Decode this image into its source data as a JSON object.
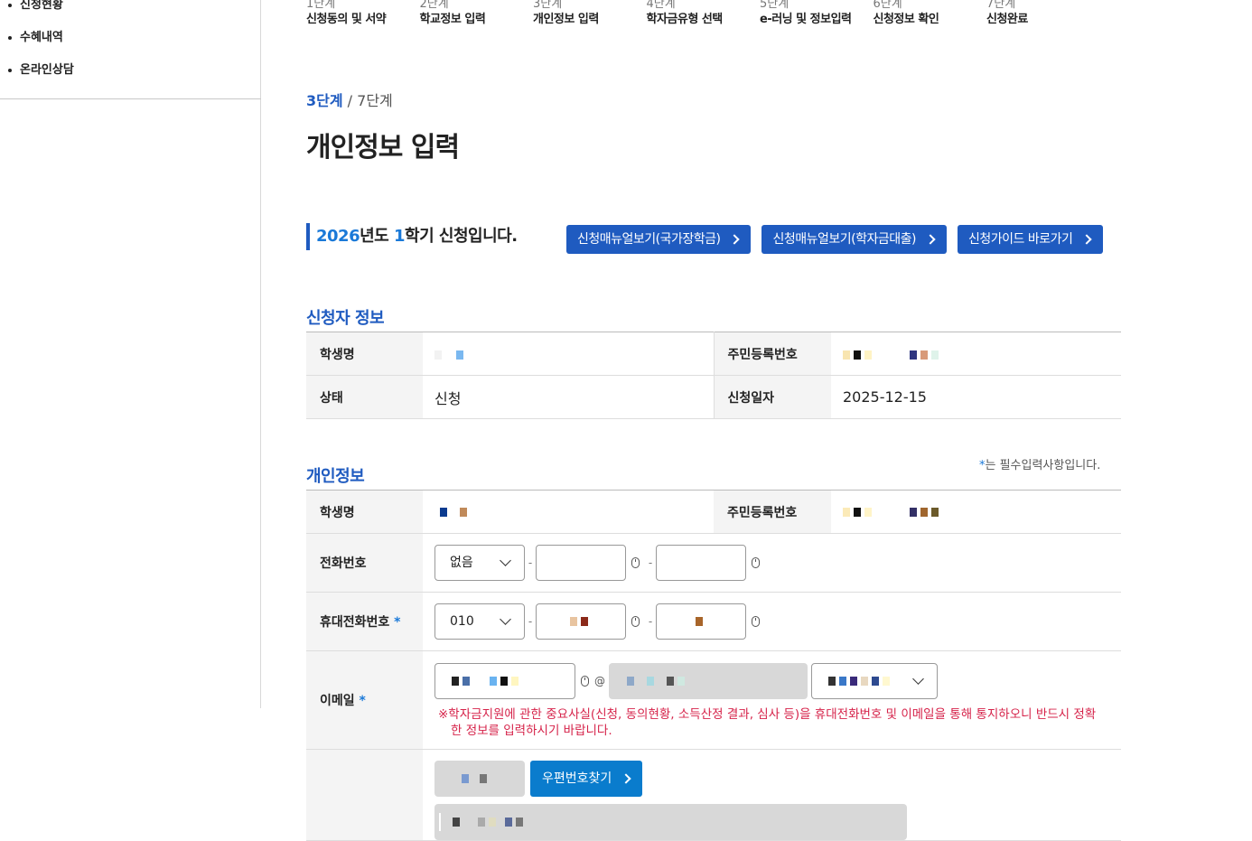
{
  "sidebar": {
    "items": [
      {
        "label": "신청현황"
      },
      {
        "label": "수혜내역"
      },
      {
        "label": "온라인상담"
      }
    ]
  },
  "steps": [
    {
      "num": "1단계",
      "name": "신청동의 및 서약"
    },
    {
      "num": "2단계",
      "name": "학교정보 입력"
    },
    {
      "num": "3단계",
      "name": "개인정보 입력"
    },
    {
      "num": "4단계",
      "name": "학자금유형 선택"
    },
    {
      "num": "5단계",
      "name": "e-러닝 및 정보입력"
    },
    {
      "num": "6단계",
      "name": "신청정보 확인"
    },
    {
      "num": "7단계",
      "name": "신청완료"
    }
  ],
  "progress": {
    "current": "3단계",
    "total": "/ 7단계"
  },
  "page_title": "개인정보 입력",
  "term": {
    "year": "2026",
    "year_suffix": "년도 ",
    "semester": "1",
    "semester_suffix": "학기 신청입니다."
  },
  "buttons": {
    "manual_national": "신청매뉴얼보기(국가장학금)",
    "manual_loan": "신청매뉴얼보기(학자금대출)",
    "guide": "신청가이드 바로가기"
  },
  "applicant": {
    "section_title": "신청자 정보",
    "name_label": "학생명",
    "rrn_label": "주민등록번호",
    "status_label": "상태",
    "status_value": "신청",
    "date_label": "신청일자",
    "date_value": "2025-12-15"
  },
  "personal": {
    "section_title": "개인정보",
    "required_note_star": "*",
    "required_note": "는 필수입력사항입니다.",
    "name_label": "학생명",
    "rrn_label": "주민등록번호",
    "phone_label": "전화번호",
    "phone_prefix": "없음",
    "mobile_label": "휴대전화번호",
    "mobile_prefix": "010",
    "email_label": "이메일",
    "email_at": "@",
    "email_notice": "※학자금지원에 관한 중요사실(신청, 동의현황, 소득산정 결과, 심사 등)을 휴대전화번호 및 이메일을 통해 통지하오니 반드시 정확한 정보를 입력하시기 바랍니다.",
    "required_star": "*",
    "zip_button": "우편번호찾기"
  },
  "colors": {
    "primary": "#1f5bc0",
    "accent": "#1a79d8",
    "zip_button": "#0a7ccd",
    "notice": "#d6234a"
  }
}
